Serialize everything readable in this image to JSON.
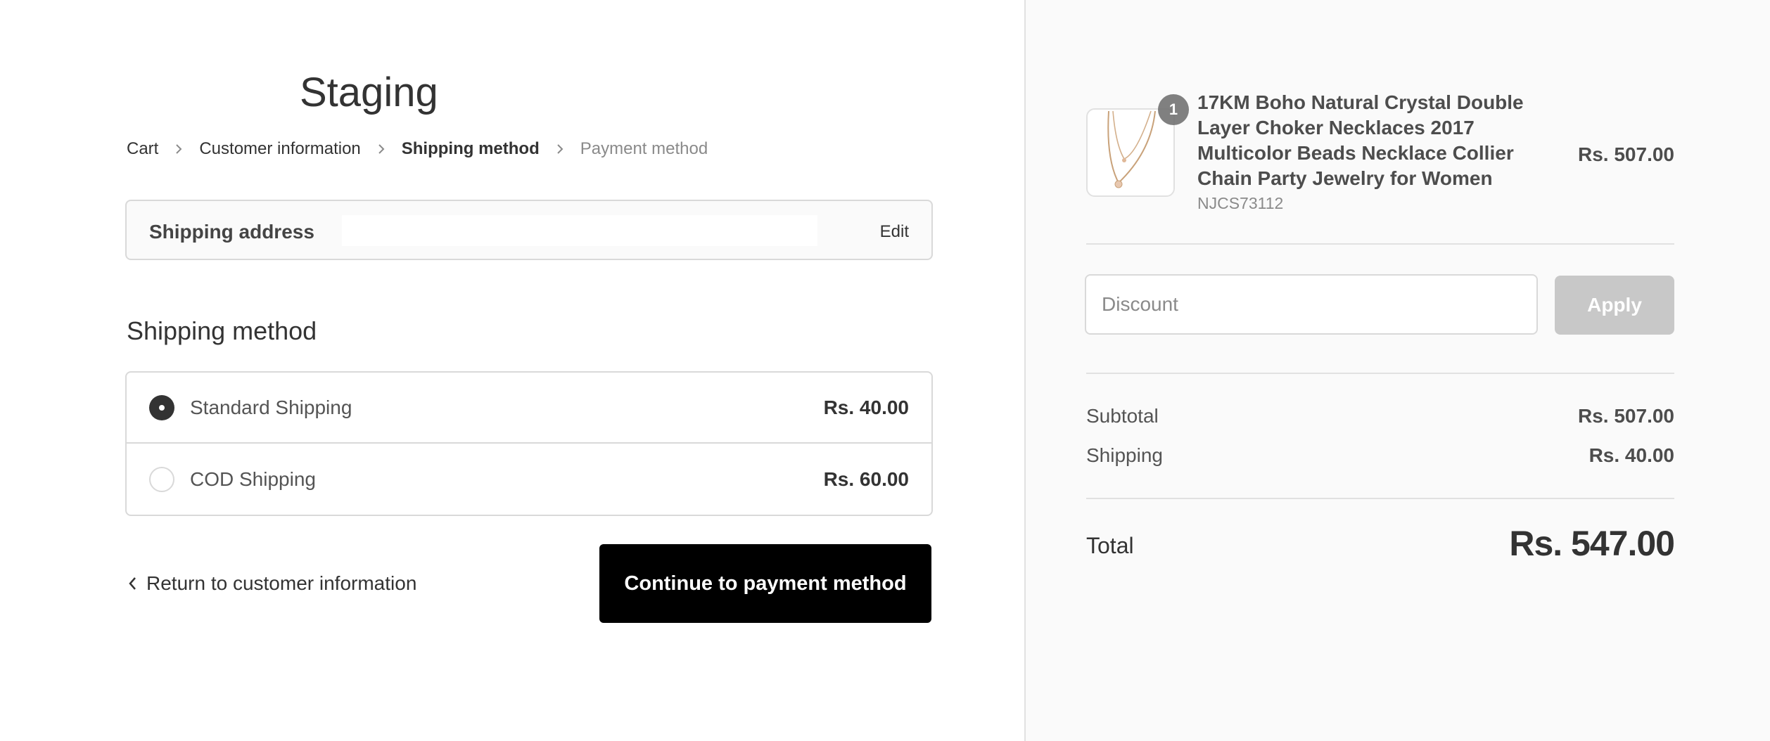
{
  "store": {
    "title": "Staging"
  },
  "breadcrumb": {
    "items": [
      {
        "label": "Cart"
      },
      {
        "label": "Customer information"
      },
      {
        "label": "Shipping method"
      },
      {
        "label": "Payment method"
      }
    ]
  },
  "address": {
    "label": "Shipping address",
    "value": "",
    "edit_label": "Edit"
  },
  "shipping": {
    "title": "Shipping method",
    "methods": [
      {
        "label": "Standard Shipping",
        "price": "Rs. 40.00",
        "selected": true
      },
      {
        "label": "COD Shipping",
        "price": "Rs. 60.00",
        "selected": false
      }
    ]
  },
  "actions": {
    "return_label": "Return to customer information",
    "continue_label": "Continue to payment method"
  },
  "order": {
    "product": {
      "quantity": "1",
      "name": "17KM Boho Natural Crystal Double Layer Choker Necklaces 2017 Multicolor Beads Necklace Collier Chain Party Jewelry for Women",
      "sku": "NJCS73112",
      "price": "Rs. 507.00"
    },
    "discount": {
      "placeholder": "Discount",
      "apply_label": "Apply"
    },
    "subtotal": {
      "label": "Subtotal",
      "value": "Rs. 507.00"
    },
    "shipping": {
      "label": "Shipping",
      "value": "Rs. 40.00"
    },
    "total": {
      "label": "Total",
      "value": "Rs. 547.00"
    }
  },
  "colors": {
    "primary_button": "#000000",
    "sidebar_bg": "#fafafa",
    "border": "#d9d9d9",
    "disabled_button": "#c8c8c8"
  }
}
